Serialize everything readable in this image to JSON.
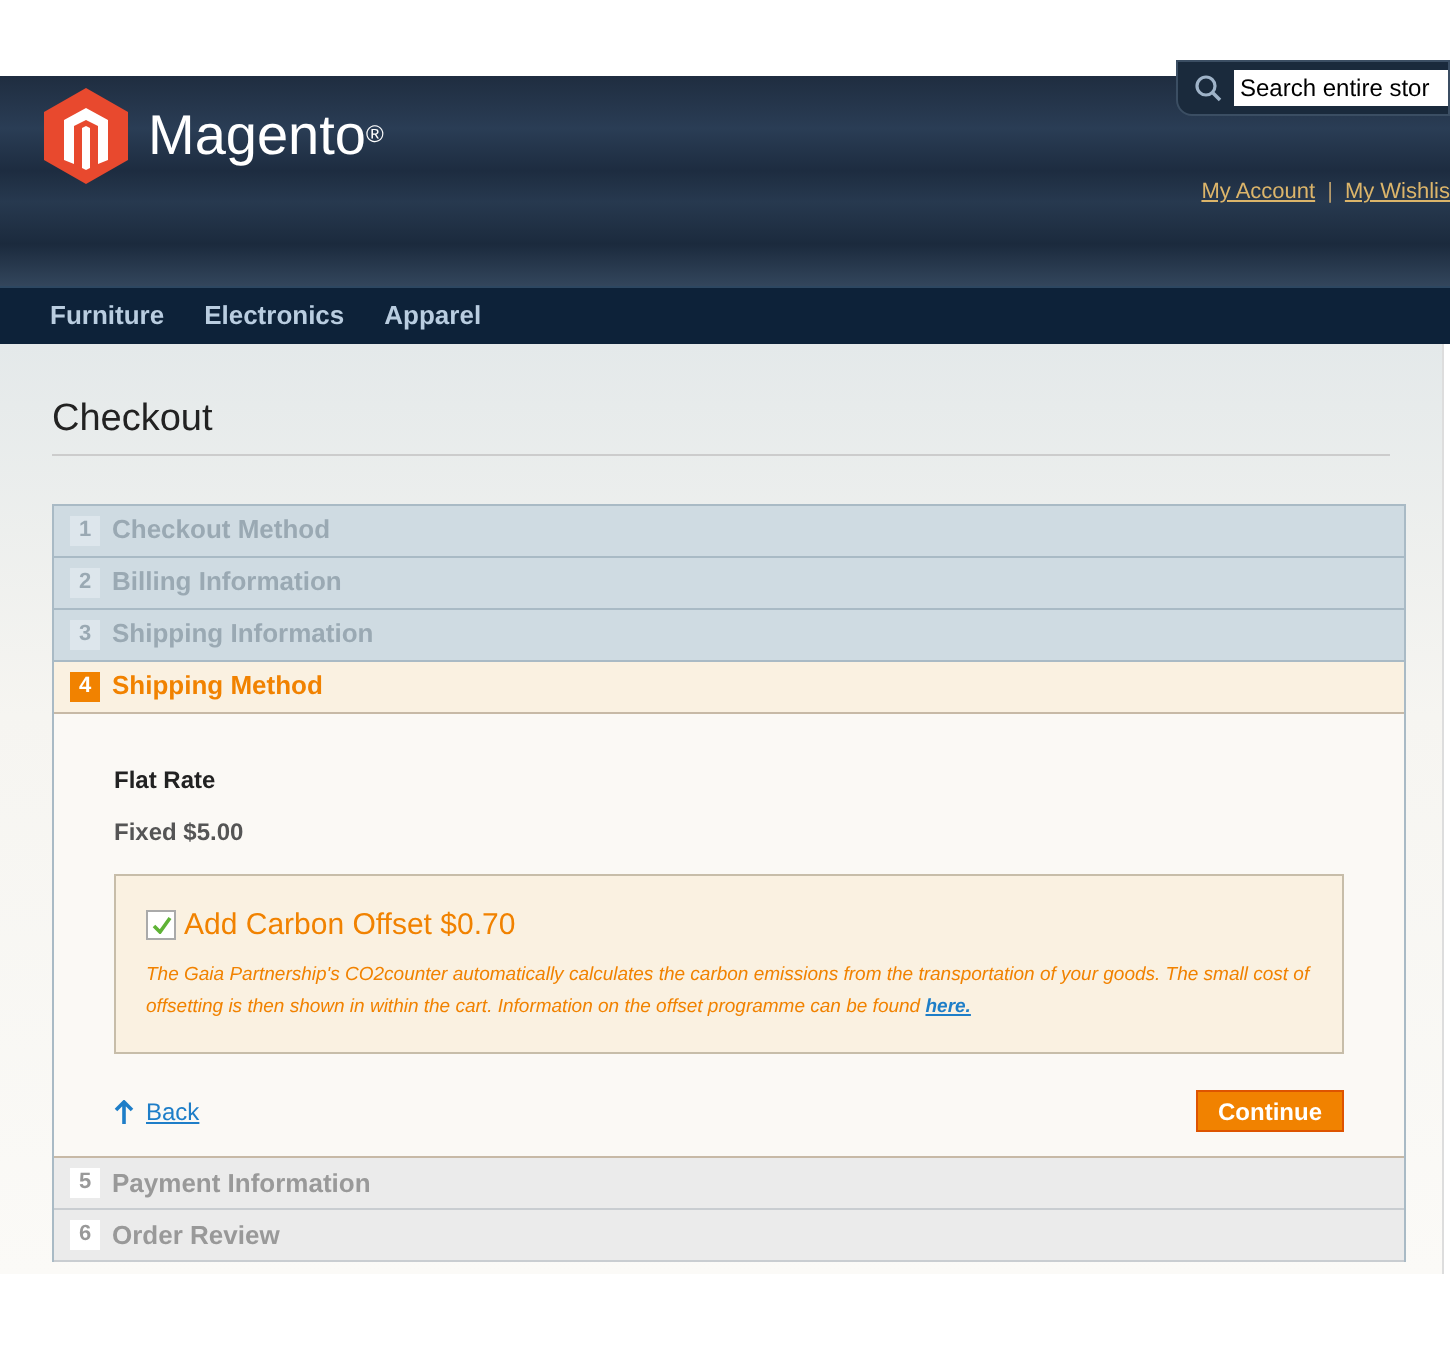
{
  "header": {
    "logo_text": "Magento",
    "logo_mark": "®",
    "search": {
      "placeholder": "Search entire stor"
    },
    "links": [
      "My Account",
      "My Wishlis"
    ],
    "link_separator": "|"
  },
  "nav": {
    "items": [
      "Furniture",
      "Electronics",
      "Apparel"
    ]
  },
  "page_title": "Checkout",
  "steps": [
    {
      "number": "1",
      "label": "Checkout Method",
      "kind": "done"
    },
    {
      "number": "2",
      "label": "Billing Information",
      "kind": "done"
    },
    {
      "number": "3",
      "label": "Shipping Information",
      "kind": "done"
    },
    {
      "number": "4",
      "label": "Shipping Method",
      "kind": "active"
    },
    {
      "number": "5",
      "label": "Payment Information",
      "kind": "pending"
    },
    {
      "number": "6",
      "label": "Order Review",
      "kind": "pending"
    }
  ],
  "shipping_method": {
    "carrier": "Flat Rate",
    "price": "Fixed $5.00",
    "carbon_offset": {
      "label": "Add Carbon Offset $0.70",
      "checked": true,
      "description": "The Gaia Partnership's CO2counter automatically calculates the carbon emissions from the transportation of your goods. The small cost of offsetting is then shown in within the cart. Information on the offset programme can be found",
      "link": "here."
    },
    "back": "Back",
    "continue": "Continue"
  }
}
